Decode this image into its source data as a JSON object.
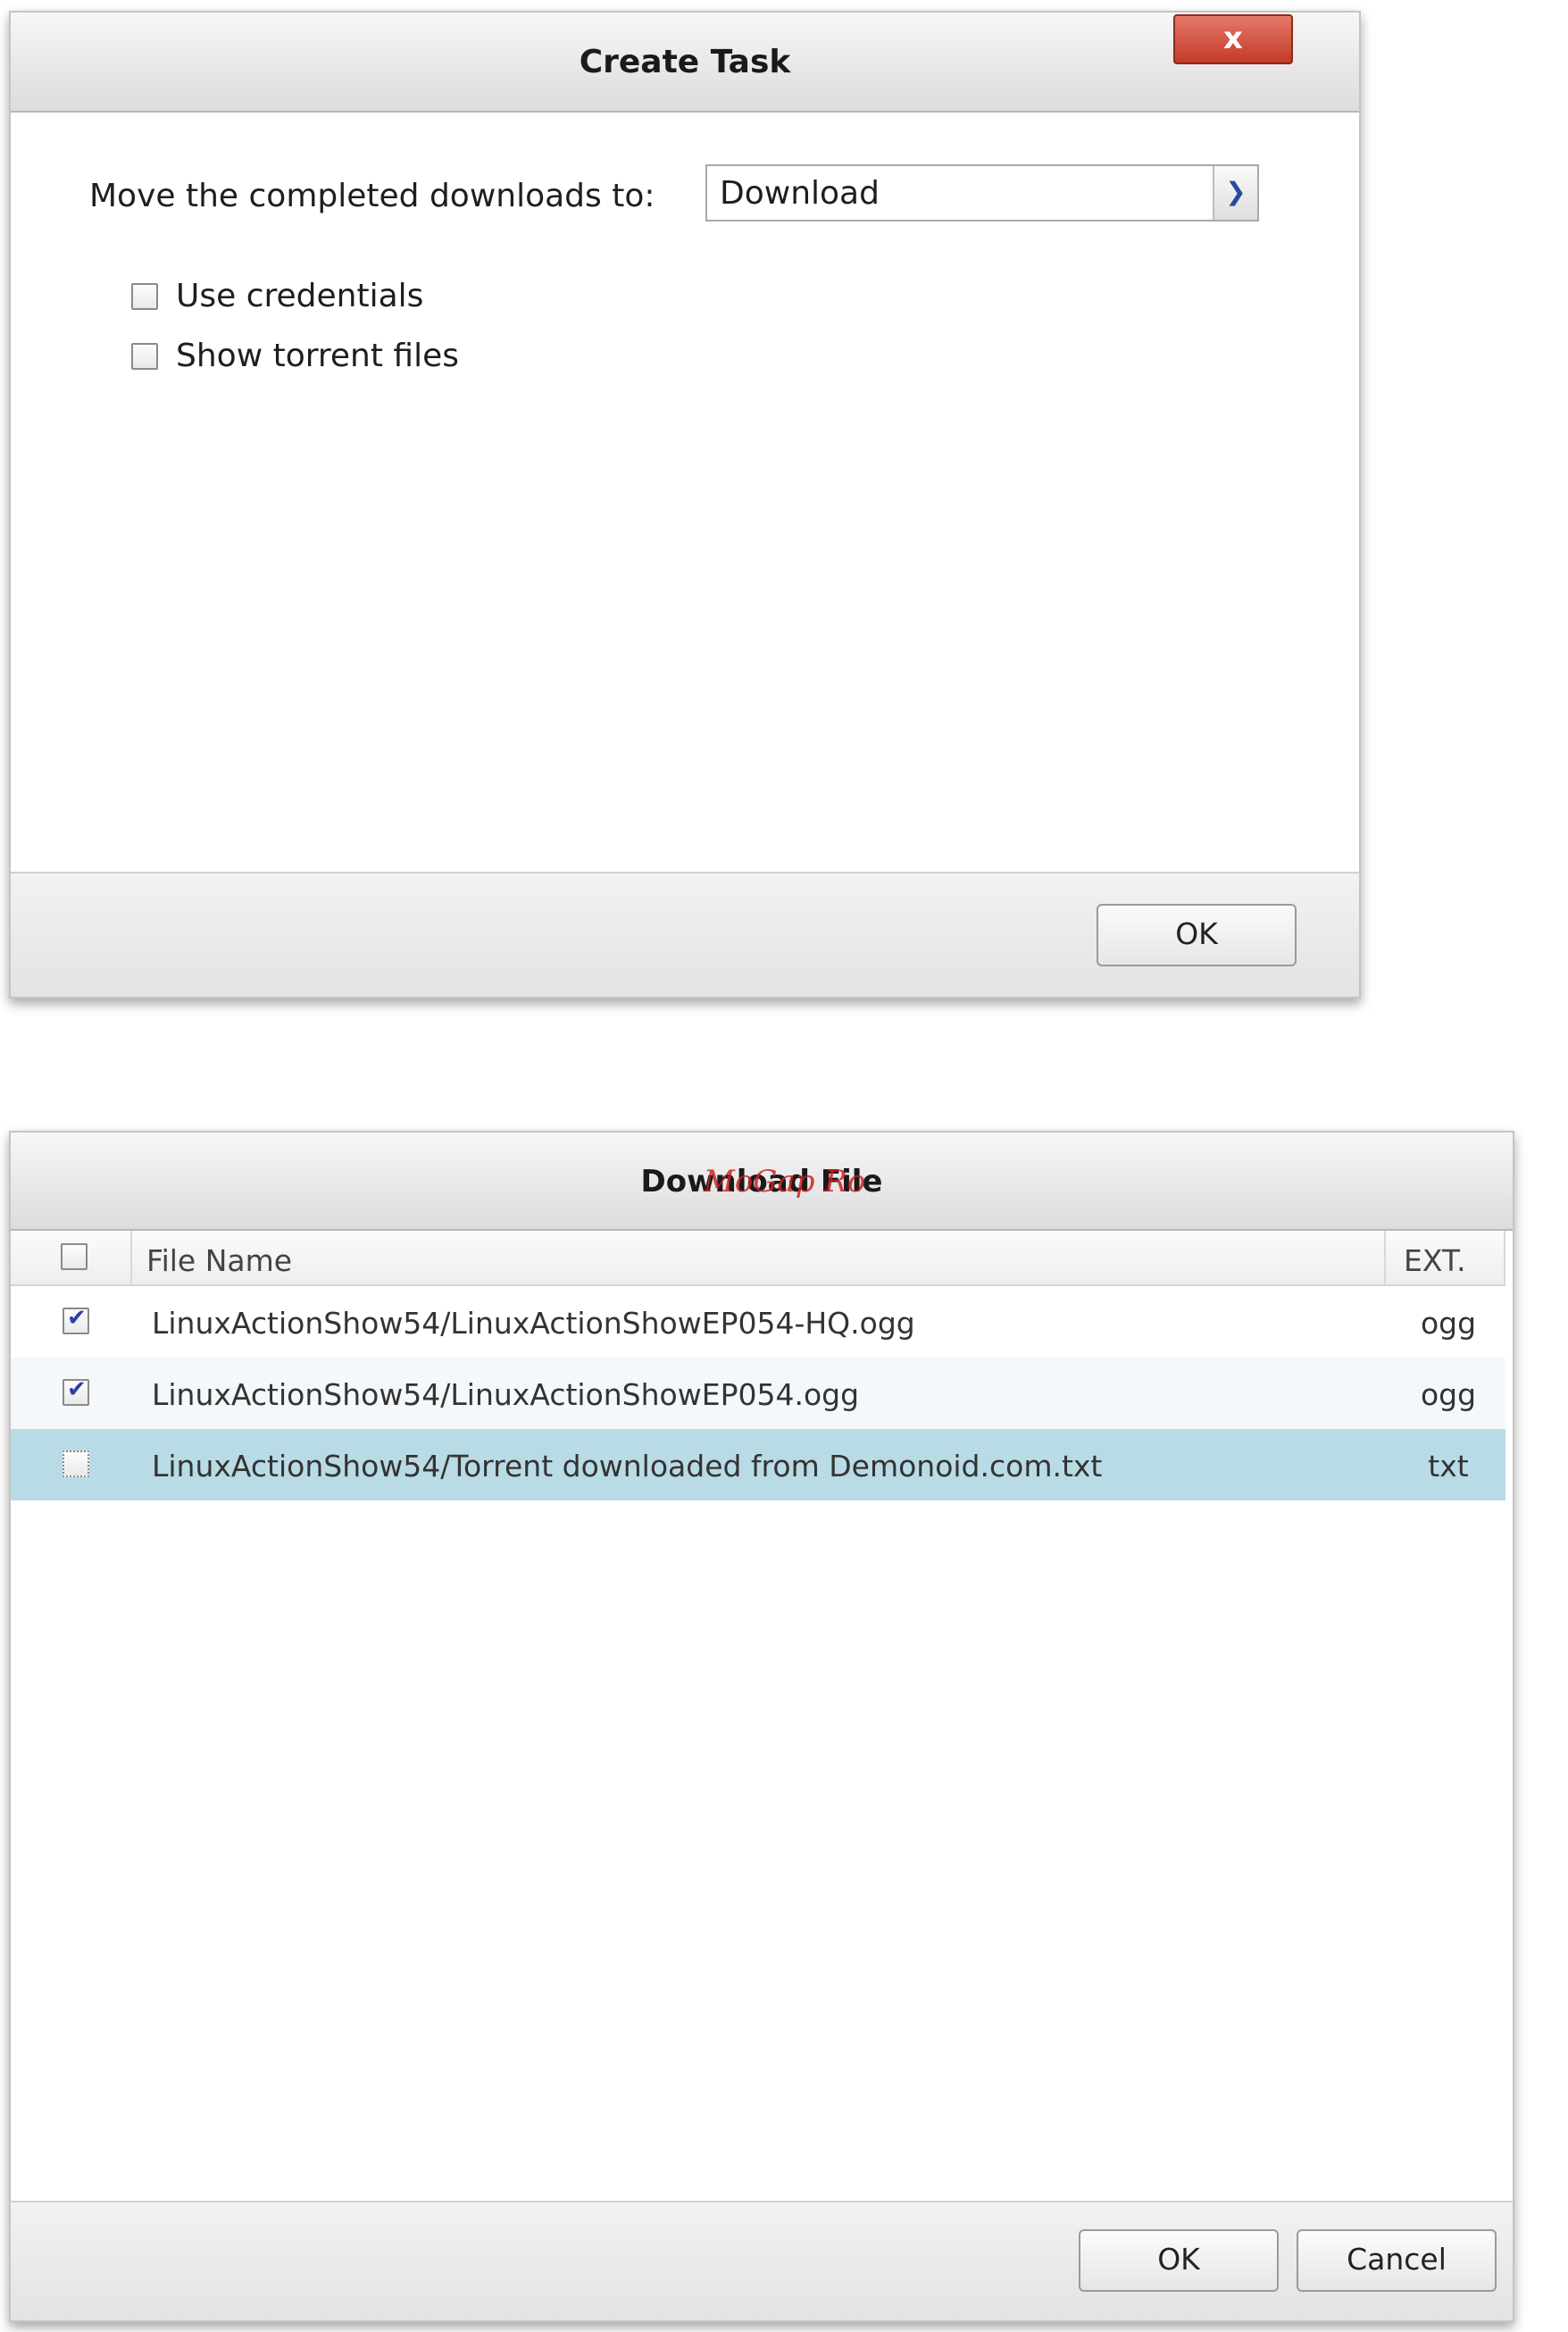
{
  "create_task": {
    "title": "Create Task",
    "close_label": "x",
    "move_label": "Move the completed downloads to:",
    "destination": "Download",
    "options": [
      {
        "label": "Use credentials",
        "checked": false
      },
      {
        "label": "Show torrent files",
        "checked": false
      }
    ],
    "ok_label": "OK"
  },
  "download_file": {
    "title": "Download File",
    "watermark": "MoGap Ro",
    "columns": {
      "name": "File Name",
      "ext": "EXT."
    },
    "files": [
      {
        "name": "LinuxActionShow54/LinuxActionShowEP054-HQ.ogg",
        "ext": "ogg",
        "checked": true
      },
      {
        "name": "LinuxActionShow54/LinuxActionShowEP054.ogg",
        "ext": "ogg",
        "checked": true
      },
      {
        "name": "LinuxActionShow54/Torrent downloaded from Demonoid.com.txt",
        "ext": "txt",
        "checked": false
      }
    ],
    "ok_label": "OK",
    "cancel_label": "Cancel"
  },
  "colors": {
    "selected_row": "#b9dbe6",
    "alt_row": "#f4f8fb",
    "close_button": "#c8412e",
    "check_mark": "#2b3fa8"
  }
}
